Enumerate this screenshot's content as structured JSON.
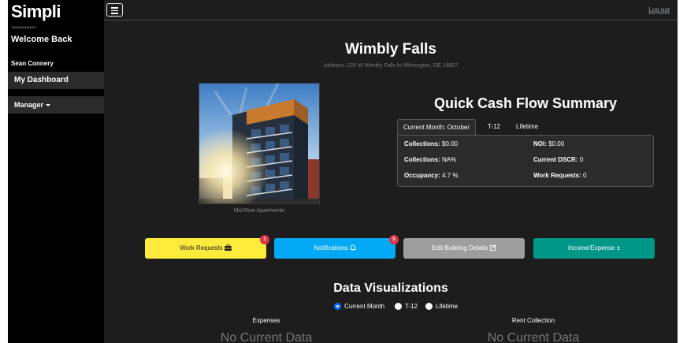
{
  "sidebar": {
    "logo": "Simpli",
    "logo_sub": "MANAGEMENT",
    "welcome": "Welcome Back",
    "user_name": "Sean Connery",
    "items": [
      {
        "label": "My Dashboard"
      },
      {
        "label": "Manager"
      }
    ]
  },
  "topbar": {
    "logout_label": "Log out"
  },
  "building": {
    "name": "Wimbly Falls",
    "address": "Address: 225 W Wimbly Falls ln Wilmington, DE 19807",
    "photo_caption": "Mid Rise Apartments"
  },
  "summary": {
    "title": "Quick Cash Flow Summary",
    "tabs": [
      {
        "label": "Current Month: October"
      },
      {
        "label": "T-12"
      },
      {
        "label": "Lifetime"
      }
    ],
    "collections_label": "Collections:",
    "collections_value": "$0.00",
    "collections_pct_label": "Collections:",
    "collections_pct_value": "NA%",
    "occupancy_label": "Occupancy:",
    "occupancy_value": "4.7 %",
    "noi_label": "NOI:",
    "noi_value": "$0.00",
    "dscr_label": "Current DSCR:",
    "dscr_value": "0",
    "work_requests_label": "Work Requests:",
    "work_requests_value": "0"
  },
  "actions": {
    "work_requests": {
      "label": "Work Requests",
      "badge": "1",
      "color": "#ffeb3b"
    },
    "notifications": {
      "label": "Notifications",
      "badge": "5",
      "color": "#03a9f4"
    },
    "edit_building": {
      "label": "Edit Building Details",
      "color": "#9e9e9e"
    },
    "income_expense": {
      "label": "Income/Expense",
      "color": "#009688"
    }
  },
  "visualizations": {
    "title": "Data Visualizations",
    "options": [
      {
        "label": "Current Month",
        "selected": true
      },
      {
        "label": "T-12"
      },
      {
        "label": "Lifetime"
      }
    ],
    "expenses_label": "Expenses",
    "expenses_empty": "No Current Data",
    "rent_label": "Rent Collection",
    "rent_empty": "No Current Data"
  },
  "icons": {
    "menu": "hamburger-icon",
    "briefcase": "briefcase-icon",
    "bell": "bell-icon",
    "edit": "edit-icon",
    "plus_minus": "plus-minus-icon"
  }
}
